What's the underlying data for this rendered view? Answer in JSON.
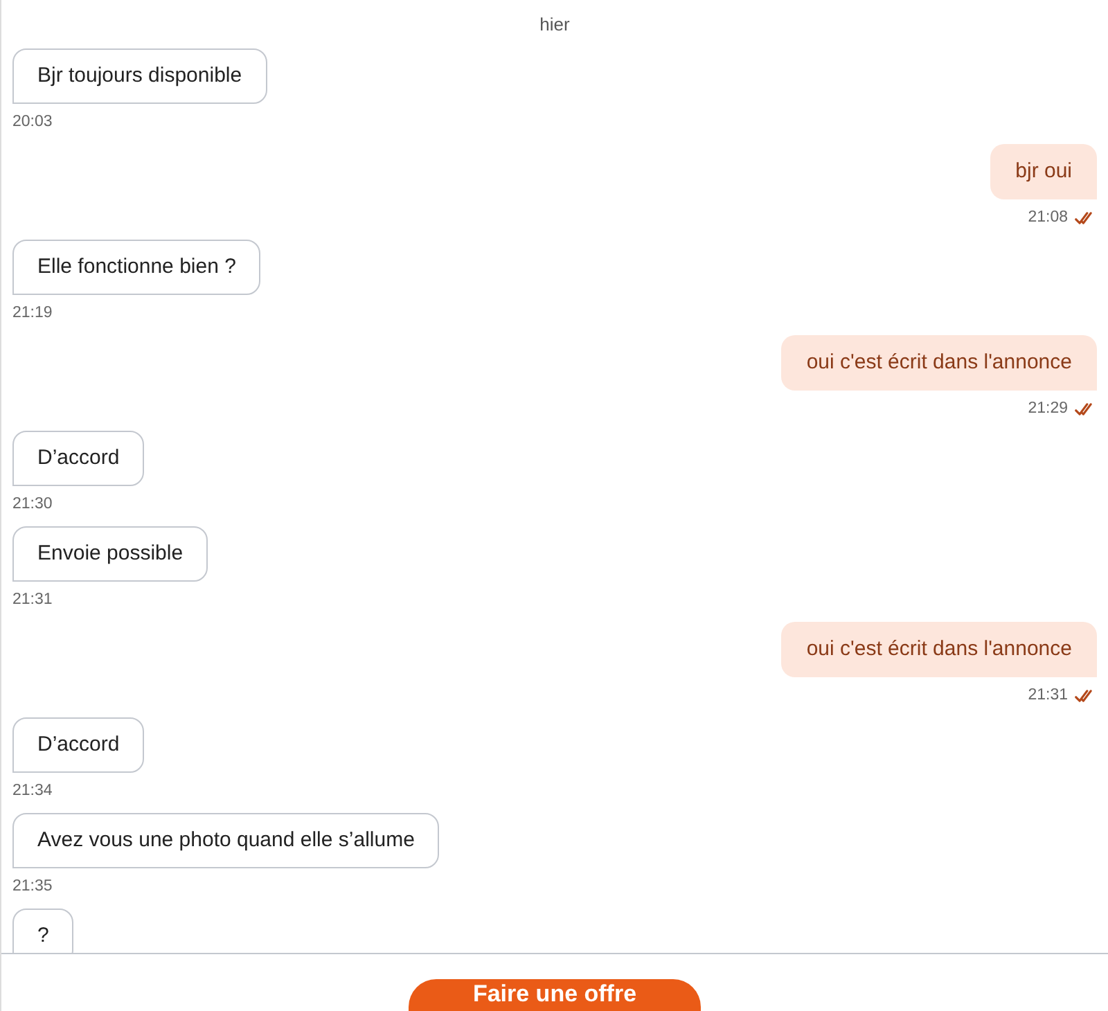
{
  "day_label": "hier",
  "messages": [
    {
      "kind": "received",
      "text": "Bjr toujours disponible",
      "time": "20:03"
    },
    {
      "kind": "sent",
      "text": "bjr oui",
      "time": "21:08",
      "read": true
    },
    {
      "kind": "received",
      "text": "Elle fonctionne bien ?",
      "time": "21:19"
    },
    {
      "kind": "sent",
      "text": "oui c'est écrit dans l'annonce",
      "time": "21:29",
      "read": true
    },
    {
      "kind": "received",
      "text": "D’accord",
      "time": "21:30"
    },
    {
      "kind": "received",
      "text": "Envoie possible",
      "time": "21:31"
    },
    {
      "kind": "sent",
      "text": "oui c'est écrit dans l'annonce",
      "time": "21:31",
      "read": true
    },
    {
      "kind": "received",
      "text": "D’accord",
      "time": "21:34"
    },
    {
      "kind": "received",
      "text": "Avez vous une photo quand elle s’allume",
      "time": "21:35"
    },
    {
      "kind": "received",
      "text": "?"
    }
  ],
  "offer_button": "Faire une offre"
}
